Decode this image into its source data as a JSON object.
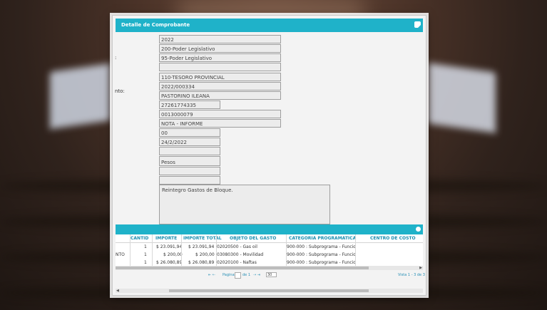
{
  "dialog": {
    "title": "Detalle de Comprobante"
  },
  "form": {
    "labels": [
      ":",
      "nto:"
    ],
    "fields": [
      "2022",
      "200-Poder Legislativo",
      "95-Poder Legislativo",
      "",
      "110-TESORO PROVINCIAL",
      "2022/000334",
      "PASTORINO ILEANA",
      "27261774335",
      "0013000079",
      "NOTA - INFORME",
      "00",
      "24/2/2022",
      "",
      "Pesos",
      "",
      ""
    ],
    "observations": "Reintegro Gastos de Bloque."
  },
  "grid": {
    "columns": [
      "CANTID",
      "IMPORTE",
      "IMPORTE TOTAL",
      "OBJETO DEL GASTO",
      "CATEGORIA PROGRAMATICA",
      "CENTRO DE COSTO"
    ],
    "rows": [
      {
        "lead": "",
        "cantidad": "1",
        "importe": "$ 23.091,94",
        "total": "$ 23.091,94",
        "objeto": "02020500 - Gas oil",
        "categoria": "900-000 : Subprograma - Funcion"
      },
      {
        "lead": "NTO",
        "cantidad": "1",
        "importe": "$ 200,00",
        "total": "$ 200,00",
        "objeto": "03080300 - Movilidad",
        "categoria": "900-000 : Subprograma - Funcion"
      },
      {
        "lead": "",
        "cantidad": "1",
        "importe": "$ 26.080,89",
        "total": "$ 26.080,89",
        "objeto": "02020100 - Naftas",
        "categoria": "900-000 : Subprograma - Funcion"
      }
    ]
  },
  "pager": {
    "nav_prev": "⇤ ⇠",
    "page_word": "Pagina",
    "of_text": "de 1",
    "nav_next": "⇢ ⇥",
    "page_size": "30",
    "view_text": "Vista 1 - 3 de 3"
  },
  "icons": {
    "close": "close-icon",
    "refresh": "refresh-icon"
  },
  "colors": {
    "accent": "#1fb2c9"
  }
}
